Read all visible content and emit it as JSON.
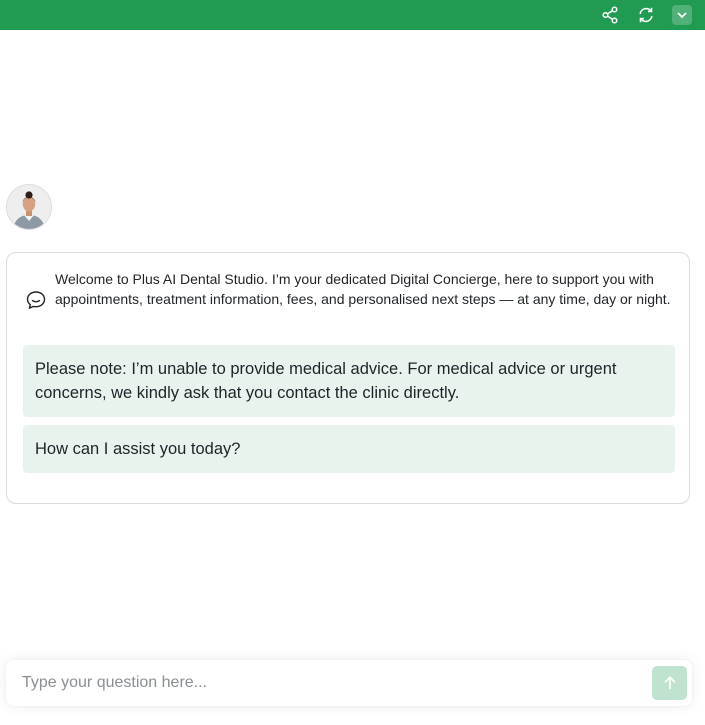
{
  "header": {
    "bg_color": "#219a52",
    "icons": [
      "share-icon",
      "refresh-icon",
      "chevron-down-icon"
    ]
  },
  "chat": {
    "welcome": "Welcome to Plus AI Dental Studio. I’m your dedicated Digital Concierge, here to support you with appointments, treatment information, fees, and personalised next steps — at any time, day or night.",
    "messages": [
      "Please note: I’m unable to provide medical advice. For medical advice or urgent concerns, we kindly ask that you contact the clinic directly.",
      "How can I assist you today?"
    ],
    "bubble_color": "#e9f3ee"
  },
  "composer": {
    "placeholder": "Type your question here...",
    "send_color": "#bfe3cf"
  }
}
